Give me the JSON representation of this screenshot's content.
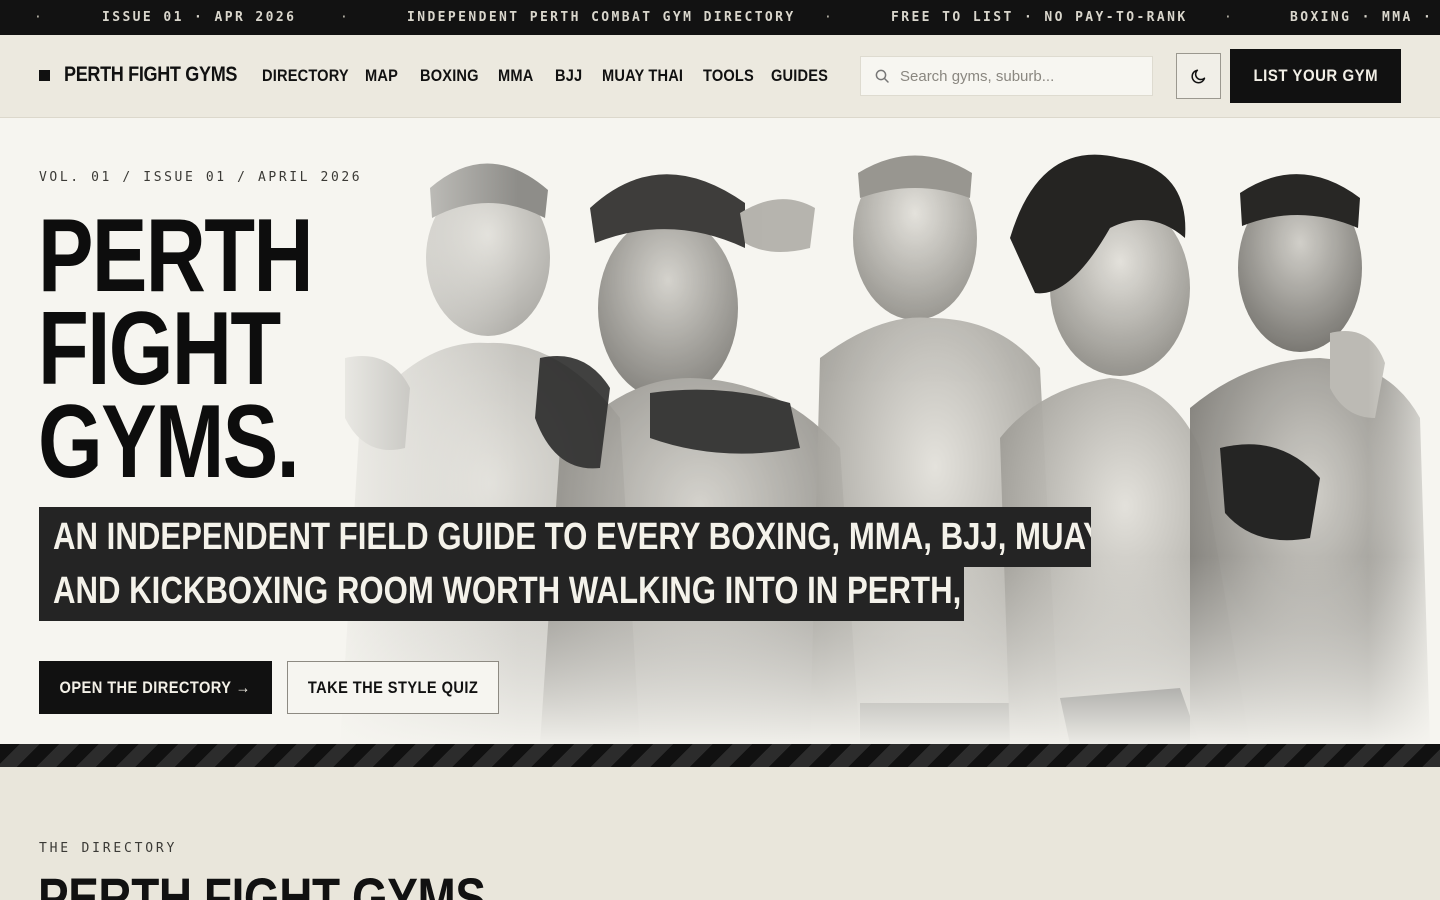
{
  "ticker": {
    "items": [
      "ISSUE 01 · APR 2026",
      "INDEPENDENT PERTH COMBAT GYM DIRECTORY",
      "FREE TO LIST · NO PAY-TO-RANK",
      "BOXING · MMA · B"
    ],
    "separator": "·"
  },
  "header": {
    "logo_text": "PERTH FIGHT GYMS",
    "nav": [
      "DIRECTORY",
      "MAP",
      "BOXING",
      "MMA",
      "BJJ",
      "MUAY THAI",
      "TOOLS",
      "GUIDES"
    ],
    "search_placeholder": "Search gyms, suburb...",
    "theme_toggle_icon": "moon-icon",
    "list_button": "LIST YOUR GYM"
  },
  "hero": {
    "issue_line": "VOL. 01 / ISSUE 01 / APRIL 2026",
    "title_lines": [
      "PERTH",
      "FIGHT",
      "GYMS."
    ],
    "subhead_lines": [
      "AN INDEPENDENT FIELD GUIDE TO EVERY BOXING, MMA, BJJ, MUAY THAI",
      "AND KICKBOXING ROOM WORTH WALKING INTO IN PERTH, WA."
    ],
    "primary_cta": "OPEN THE DIRECTORY →",
    "secondary_cta": "TAKE THE STYLE QUIZ"
  },
  "directory": {
    "kicker": "THE DIRECTORY",
    "title": "PERTH FIGHT GYMS"
  },
  "colors": {
    "ink": "#111111",
    "paper": "#f6f5f0",
    "header_bg": "#ece9df",
    "ticker_bg": "#121212"
  }
}
